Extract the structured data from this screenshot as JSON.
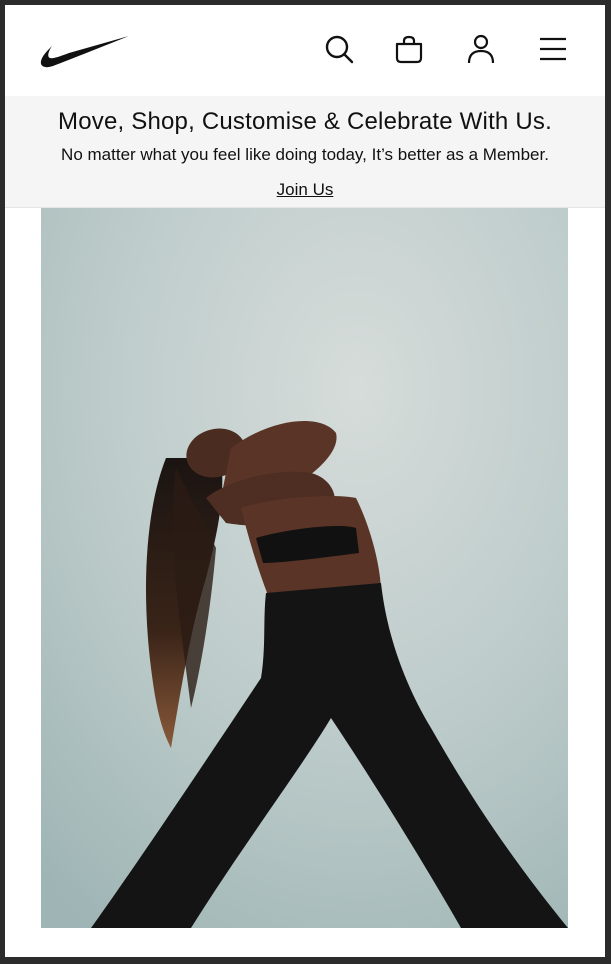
{
  "header": {
    "logo_icon": "nike-swoosh-logo",
    "icons": [
      "search-icon",
      "bag-icon",
      "account-icon",
      "menu-icon"
    ]
  },
  "banner": {
    "title": "Move, Shop, Customise & Celebrate With Us.",
    "subtitle": "No matter what you feel like doing today, It’s better as a Member.",
    "join_label": "Join Us"
  },
  "hero": {
    "image_subject": "athlete-stretching-against-sky"
  },
  "colors": {
    "brand_black": "#111111",
    "banner_bg": "#f5f5f5",
    "sky": "#b9cac9"
  }
}
